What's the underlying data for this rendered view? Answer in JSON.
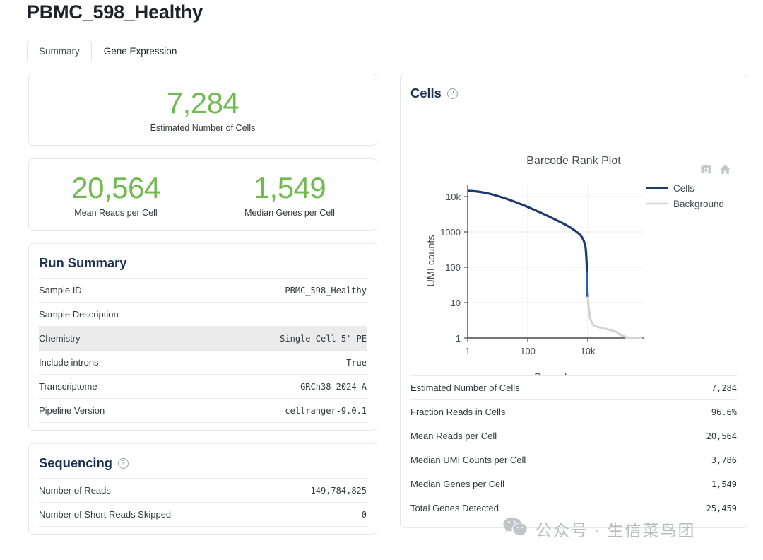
{
  "page": {
    "title": "PBMC_598_Healthy"
  },
  "tabs": [
    {
      "label": "Summary",
      "active": true
    },
    {
      "label": "Gene Expression",
      "active": false
    }
  ],
  "hero_cards": [
    {
      "items": [
        {
          "value": "7,284",
          "label": "Estimated Number of Cells"
        }
      ]
    },
    {
      "items": [
        {
          "value": "20,564",
          "label": "Mean Reads per Cell"
        },
        {
          "value": "1,549",
          "label": "Median Genes per Cell"
        }
      ]
    }
  ],
  "run_summary": {
    "title": "Run Summary",
    "rows": [
      {
        "key": "Sample ID",
        "value": "PBMC_598_Healthy",
        "highlight": false
      },
      {
        "key": "Sample Description",
        "value": "",
        "highlight": false
      },
      {
        "key": "Chemistry",
        "value": "Single Cell 5' PE",
        "highlight": true
      },
      {
        "key": "Include introns",
        "value": "True",
        "highlight": false
      },
      {
        "key": "Transcriptome",
        "value": "GRCh38-2024-A",
        "highlight": false
      },
      {
        "key": "Pipeline Version",
        "value": "cellranger-9.0.1",
        "highlight": false
      }
    ]
  },
  "sequencing": {
    "title": "Sequencing",
    "help_icon": "help-circle-icon",
    "rows": [
      {
        "key": "Number of Reads",
        "value": "149,784,825"
      },
      {
        "key": "Number of Short Reads Skipped",
        "value": "0"
      }
    ]
  },
  "cells": {
    "title": "Cells",
    "help_icon": "help-circle-icon",
    "modebar": [
      {
        "name": "download-plot-icon",
        "title": "Download plot as a png"
      },
      {
        "name": "home-reset-axes-icon",
        "title": "Reset axes"
      }
    ],
    "rows": [
      {
        "key": "Estimated Number of Cells",
        "value": "7,284"
      },
      {
        "key": "Fraction Reads in Cells",
        "value": "96.6%"
      },
      {
        "key": "Mean Reads per Cell",
        "value": "20,564"
      },
      {
        "key": "Median UMI Counts per Cell",
        "value": "3,786"
      },
      {
        "key": "Median Genes per Cell",
        "value": "1,549"
      },
      {
        "key": "Total Genes Detected",
        "value": "25,459"
      }
    ]
  },
  "chart_data": {
    "type": "line",
    "title": "Barcode Rank Plot",
    "xlabel": "Barcodes",
    "ylabel": "UMI counts",
    "xscale": "log",
    "yscale": "log",
    "xlim": [
      1,
      60000
    ],
    "ylim": [
      1,
      40000
    ],
    "xticks": [
      "1",
      "100",
      "10k"
    ],
    "xtick_values": [
      1,
      100,
      10000
    ],
    "yticks": [
      "1",
      "10",
      "100",
      "1000",
      "10k"
    ],
    "ytick_values": [
      1,
      10,
      100,
      1000,
      10000
    ],
    "grid": true,
    "legend_position": "right",
    "colors": {
      "cells": "#1b3b6f",
      "background": "#d4d4d4",
      "accent_blue": "#1f63b5"
    },
    "series": [
      {
        "name": "Cells",
        "color": "#1b3b6f",
        "x": [
          1,
          2,
          4,
          8,
          16,
          32,
          64,
          130,
          260,
          520,
          1000,
          1700,
          2600,
          3600,
          4600,
          5500,
          6200,
          6700,
          7000,
          7180,
          7250,
          7284
        ],
        "y": [
          26000,
          25500,
          24500,
          23200,
          21500,
          19500,
          17000,
          14500,
          12000,
          9500,
          7200,
          5600,
          4400,
          3600,
          3100,
          2800,
          2650,
          2500,
          2100,
          1400,
          820,
          520
        ]
      },
      {
        "name": "Background",
        "color": "#d4d4d4",
        "x": [
          7284,
          7400,
          7600,
          7900,
          8300,
          8800,
          9400,
          10000,
          11000,
          12500,
          14000,
          16000,
          19000,
          22000,
          25000,
          27000,
          28500,
          30000,
          34000,
          40000,
          50000
        ],
        "y": [
          520,
          330,
          190,
          110,
          62,
          38,
          26,
          21,
          18,
          14,
          11,
          8,
          6,
          4.5,
          3.4,
          2.6,
          2.0,
          1.4,
          1.0,
          1.0,
          1.0
        ]
      }
    ]
  },
  "watermark": {
    "icon": "wechat-icon",
    "text": "公众号 · 生信菜鸟团"
  }
}
